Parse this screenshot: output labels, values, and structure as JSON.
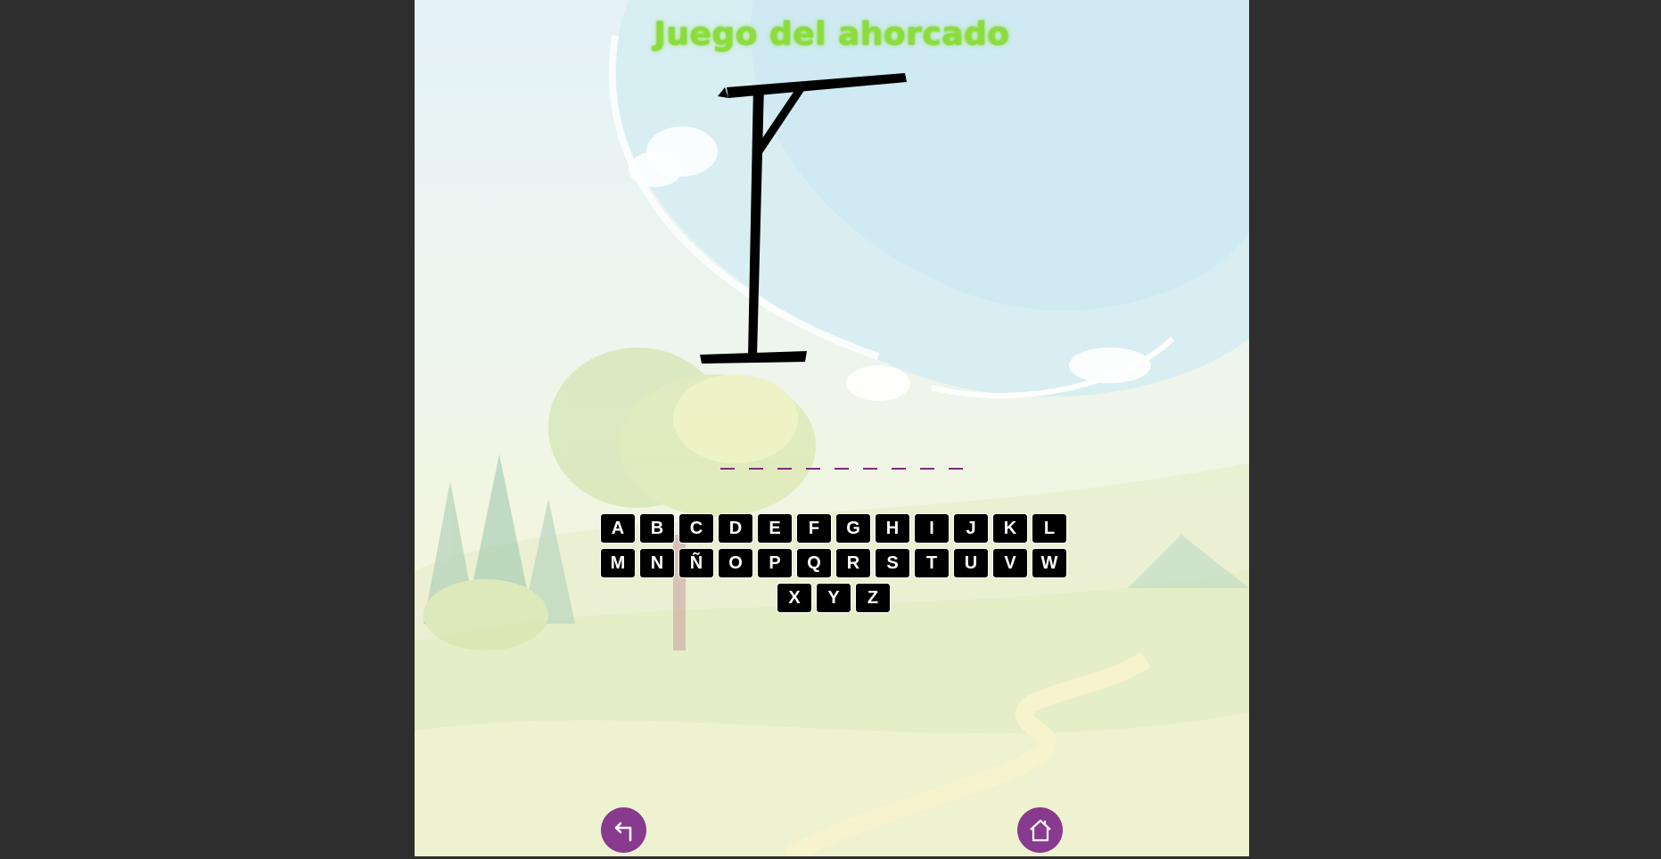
{
  "title": "Juego del ahorcado",
  "word_slots": 9,
  "keyboard": {
    "keys": [
      "A",
      "B",
      "C",
      "D",
      "E",
      "F",
      "G",
      "H",
      "I",
      "J",
      "K",
      "L",
      "M",
      "N",
      "Ñ",
      "O",
      "P",
      "Q",
      "R",
      "S",
      "T",
      "U",
      "V",
      "W",
      "X",
      "Y",
      "Z"
    ]
  },
  "nav": {
    "back_icon": "back-arrow-icon",
    "home_icon": "home-icon"
  },
  "colors": {
    "page_bg": "#2e2e2e",
    "title": "#8ddc3e",
    "key_bg": "#000000",
    "key_text": "#ffffff",
    "nav_button": "#883a8e",
    "word_slot": "#7b2d7b"
  }
}
